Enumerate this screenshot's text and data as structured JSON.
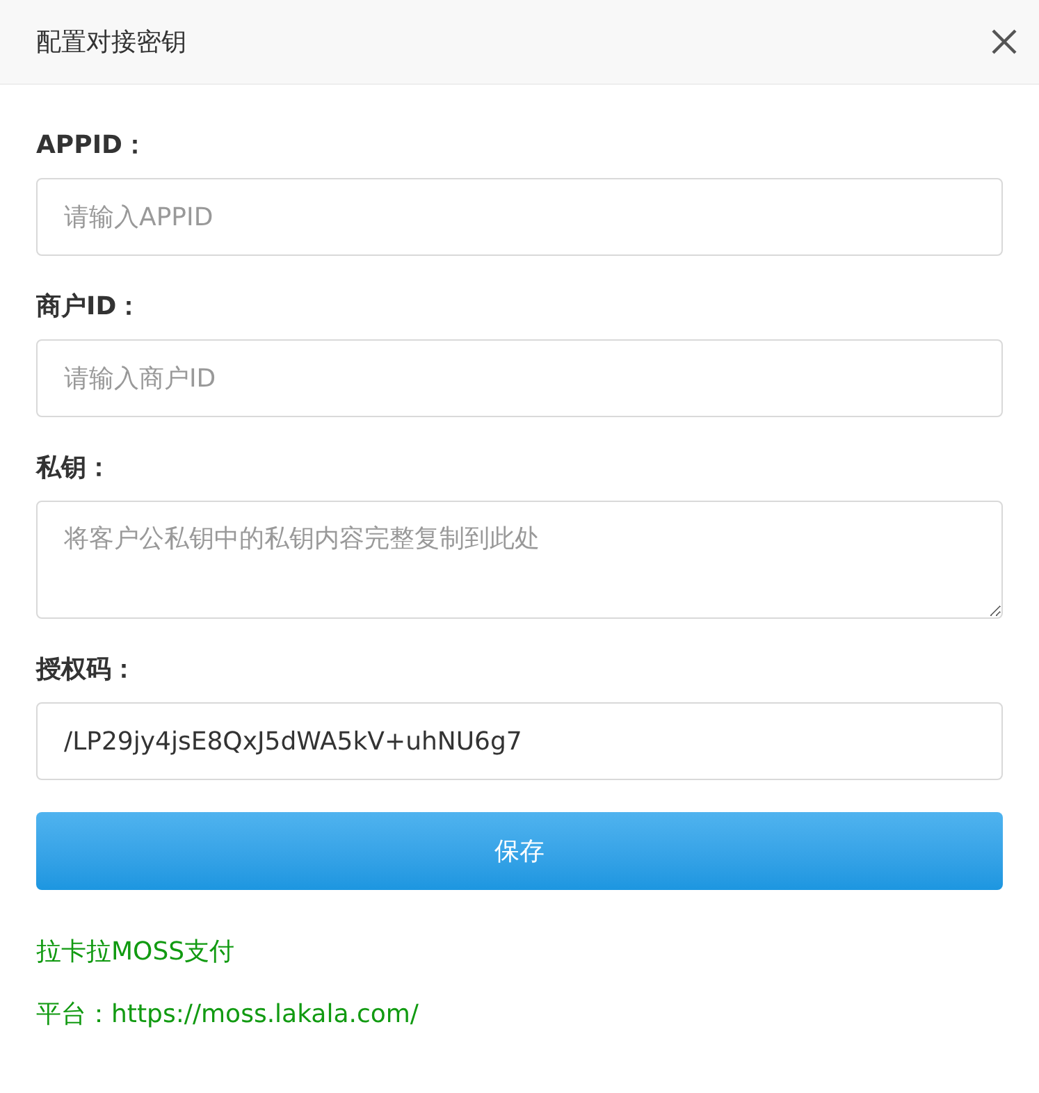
{
  "dialog": {
    "title": "配置对接密钥",
    "fields": [
      {
        "label": "APPID：",
        "kind": "input",
        "placeholder": "请输入APPID"
      },
      {
        "label": "商户ID：",
        "kind": "input",
        "placeholder": "请输入商户ID"
      },
      {
        "label": "私钥：",
        "kind": "textarea",
        "placeholder": "将客户公私钥中的私钥内容完整复制到此处"
      },
      {
        "label": "授权码：",
        "kind": "input",
        "value": "/LP29jy4jsE8QxJ5dWA5kV+uhNU6g7"
      }
    ],
    "save_button": "保存",
    "notes": [
      "拉卡拉MOSS支付",
      "平台：https://moss.lakala.com/"
    ]
  }
}
